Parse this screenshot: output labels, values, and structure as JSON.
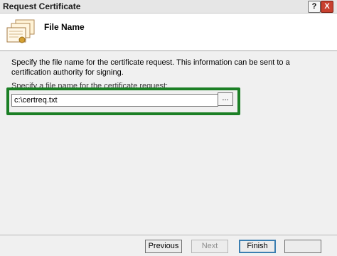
{
  "window": {
    "title": "Request Certificate",
    "help_label": "?",
    "close_label": "X"
  },
  "header": {
    "title": "File Name",
    "icon": "certificate-stack-icon"
  },
  "body": {
    "instruction": "Specify the file name for the certificate request. This information can be sent to a certification authority for signing.",
    "field_label": "Specify a file name for the certificate request:",
    "filename_value": "c:\\certreq.txt",
    "browse_label": "..."
  },
  "footer": {
    "previous": "Previous",
    "next": "Next",
    "finish": "Finish",
    "cancel": ""
  },
  "colors": {
    "highlight": "#1b7f25",
    "close": "#c8402f"
  }
}
